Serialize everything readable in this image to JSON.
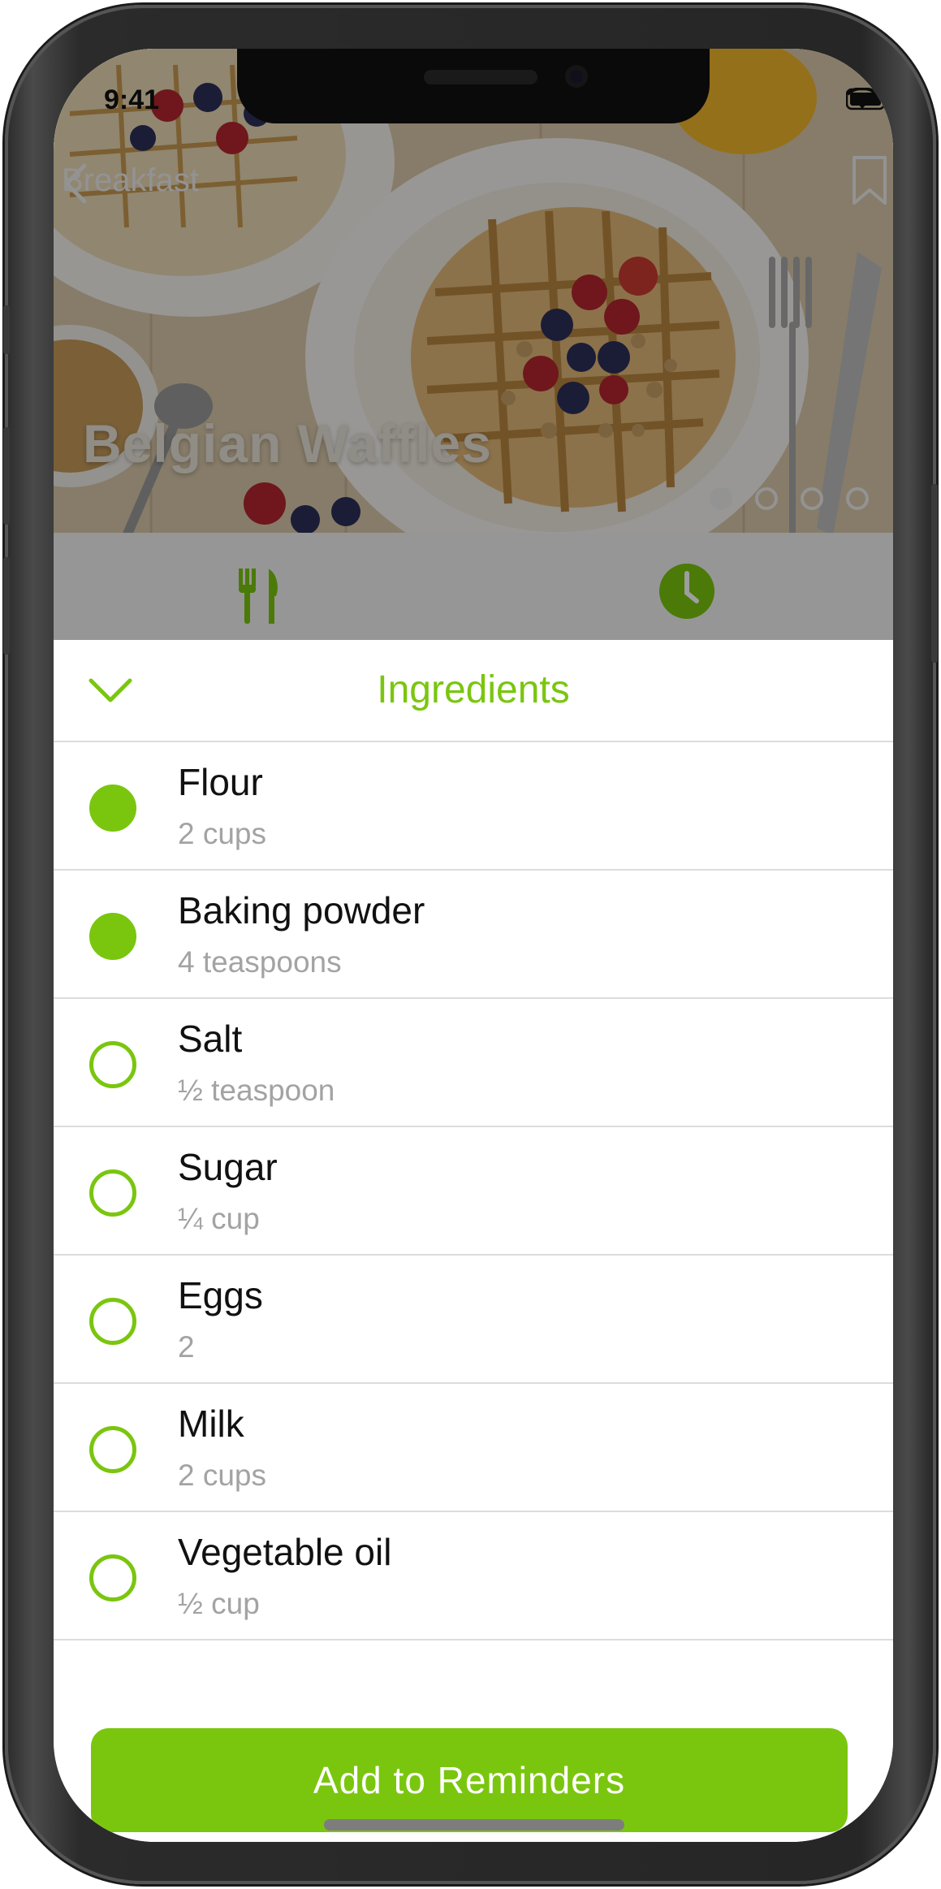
{
  "status_bar": {
    "time": "9:41"
  },
  "nav": {
    "back_label": "Breakfast"
  },
  "hero": {
    "title": "Belgian Waffles",
    "page_count": 4,
    "active_page": 1
  },
  "sheet": {
    "title": "Ingredients"
  },
  "ingredients": [
    {
      "name": "Flour",
      "qty": "2 cups",
      "checked": true
    },
    {
      "name": "Baking powder",
      "qty": "4 teaspoons",
      "checked": true
    },
    {
      "name": "Salt",
      "qty": "½ teaspoon",
      "checked": false
    },
    {
      "name": "Sugar",
      "qty": "¼ cup",
      "checked": false
    },
    {
      "name": "Eggs",
      "qty": "2",
      "checked": false
    },
    {
      "name": "Milk",
      "qty": "2 cups",
      "checked": false
    },
    {
      "name": "Vegetable oil",
      "qty": "½ cup",
      "checked": false
    }
  ],
  "actions": {
    "add_reminders_label": "Add to Reminders"
  },
  "colors": {
    "accent": "#7ac60f",
    "secondary_text": "#a3a3a3",
    "separator": "#dcdcdc"
  }
}
